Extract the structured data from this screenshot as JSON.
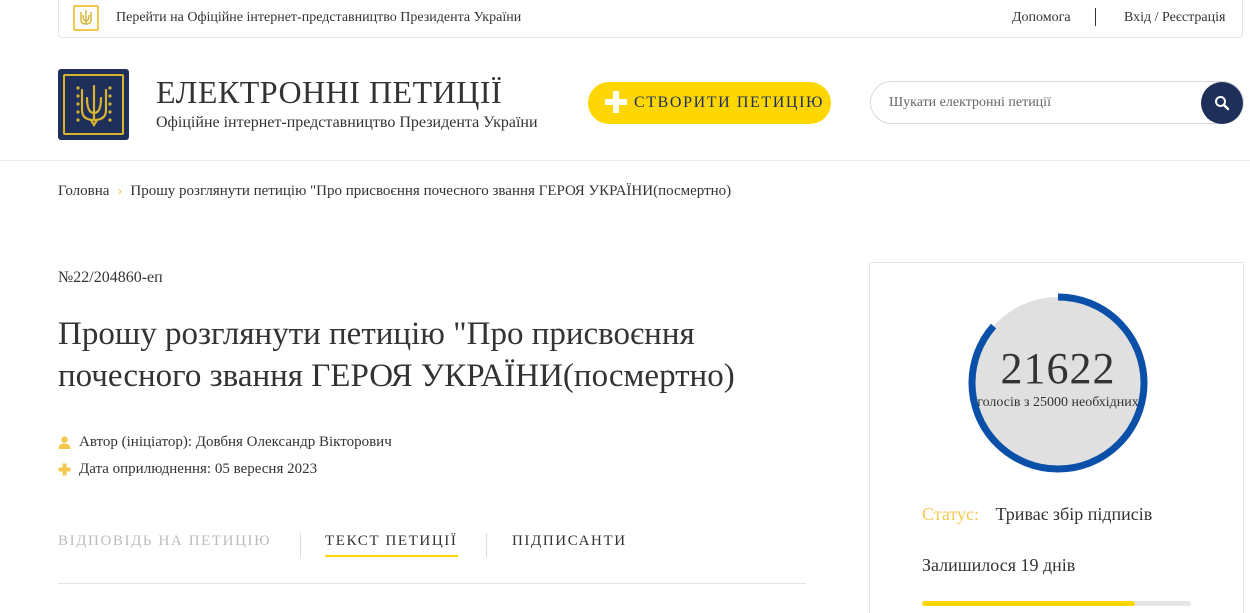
{
  "topbar": {
    "portal_link": "Перейти на Офіційне інтернет-представництво Президента України",
    "help": "Допомога",
    "login": "Вхід / Реєстрація"
  },
  "header": {
    "title": "ЕЛЕКТРОННІ ПЕТИЦІЇ",
    "subtitle": "Офіційне інтернет-представництво Президента України",
    "create_button": "СТВОРИТИ ПЕТИЦІЮ",
    "search_placeholder": "Шукати електронні петиції"
  },
  "breadcrumb": {
    "home": "Головна",
    "current": "Прошу розглянути петицію \"Про присвоєння почесного звання ГЕРОЯ УКРАЇНИ(посмертно)"
  },
  "petition": {
    "number": "№22/204860-еп",
    "title": "Прошу розглянути петицію \"Про присвоєння почесного звання ГЕРОЯ УКРАЇНИ(посмертно)",
    "author": "Автор (ініціатор): Довбня Олександр Вікторович",
    "date": "Дата оприлюднення: 05 вересня 2023"
  },
  "tabs": [
    {
      "label": "ВІДПОВІДЬ НА ПЕТИЦІЮ",
      "active": false
    },
    {
      "label": "ТЕКСТ ПЕТИЦІЇ",
      "active": true
    },
    {
      "label": "ПІДПИСАНТИ",
      "active": false
    }
  ],
  "sidebar": {
    "votes": "21622",
    "votes_caption": "голосів з 25000 необхідних",
    "votes_fraction": 0.86488,
    "status_label": "Статус:",
    "status_value": "Триває збір підписів",
    "remaining": "Залишилося 19 днів",
    "remaining_fraction": 0.79
  },
  "colors": {
    "accent_yellow": "#ffd700",
    "navy": "#1e2f5a",
    "gauge_blue": "#0a50a8",
    "gauge_track": "#e0e0e0"
  }
}
